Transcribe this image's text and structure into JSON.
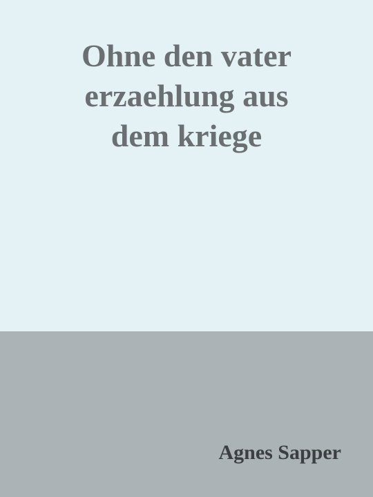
{
  "cover": {
    "title_lines": [
      "Ohne den vater",
      "erzaehlung aus",
      "dem kriege"
    ],
    "author": "Agnes Sapper",
    "colors": {
      "top_background": "#e4f1f5",
      "bottom_background": "#abb3b6",
      "title_text": "#6a7072",
      "author_text": "#3b3f41"
    }
  }
}
